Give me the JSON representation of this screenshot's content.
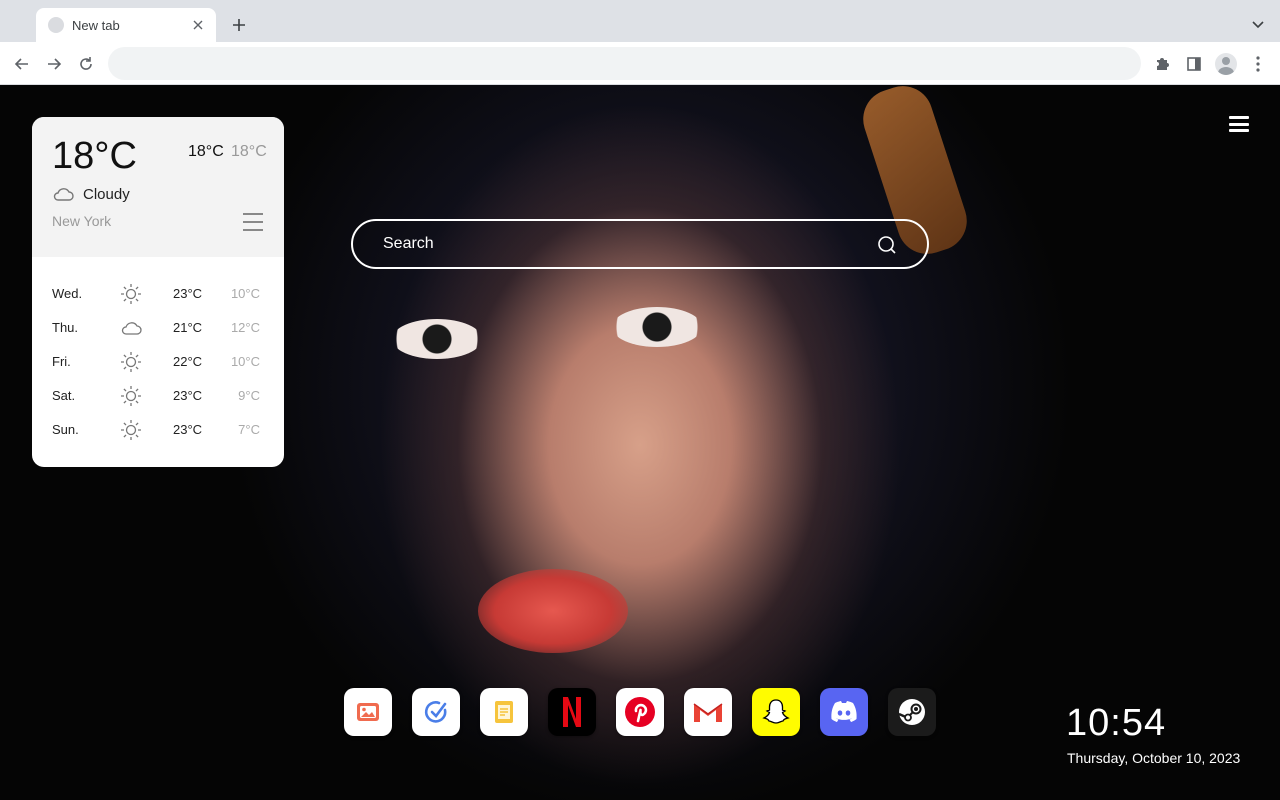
{
  "browser": {
    "tab_title": "New tab",
    "address_value": ""
  },
  "weather": {
    "current_temp": "18°C",
    "high": "18°C",
    "low": "18°C",
    "condition": "Cloudy",
    "condition_icon": "cloud-icon",
    "city": "New York",
    "forecast": [
      {
        "day": "Wed.",
        "icon": "sun-icon",
        "high": "23°C",
        "low": "10°C"
      },
      {
        "day": "Thu.",
        "icon": "cloud-icon",
        "high": "21°C",
        "low": "12°C"
      },
      {
        "day": "Fri.",
        "icon": "sun-icon",
        "high": "22°C",
        "low": "10°C"
      },
      {
        "day": "Sat.",
        "icon": "sun-icon",
        "high": "23°C",
        "low": "9°C"
      },
      {
        "day": "Sun.",
        "icon": "sun-icon",
        "high": "23°C",
        "low": "7°C"
      }
    ]
  },
  "search": {
    "placeholder": "Search"
  },
  "dock": [
    {
      "name": "gallery",
      "icon": "image-icon",
      "color": "#ffffff"
    },
    {
      "name": "tasks",
      "icon": "check-circle-icon",
      "color": "#ffffff"
    },
    {
      "name": "notes",
      "icon": "note-icon",
      "color": "#ffffff"
    },
    {
      "name": "netflix",
      "icon": "netflix-icon",
      "color": "#000000"
    },
    {
      "name": "pinterest",
      "icon": "pinterest-icon",
      "color": "#ffffff"
    },
    {
      "name": "gmail",
      "icon": "gmail-icon",
      "color": "#ffffff"
    },
    {
      "name": "snapchat",
      "icon": "snapchat-icon",
      "color": "#fffc00"
    },
    {
      "name": "discord",
      "icon": "discord-icon",
      "color": "#5865f2"
    },
    {
      "name": "steam",
      "icon": "steam-icon",
      "color": "#1b1b1b"
    }
  ],
  "clock": {
    "time": "10:54",
    "date": "Thursday, October 10, 2023"
  }
}
